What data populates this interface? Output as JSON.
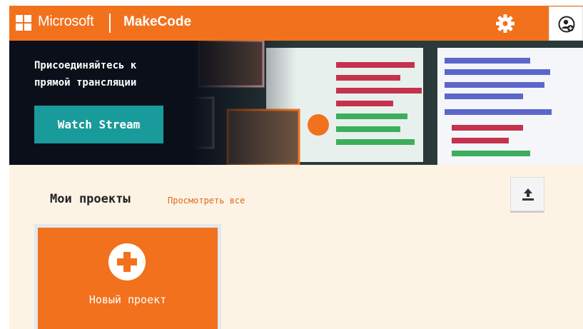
{
  "header": {
    "brand_ms": "Microsoft",
    "brand_product": "MakeCode",
    "settings_icon": "gear-icon",
    "user_icon": "user-sign-in-icon",
    "accent_color": "#f2711c"
  },
  "hero": {
    "title": "Присоединяйтесь к прямой трансляции",
    "button_label": "Watch Stream",
    "button_color": "#1a9b9b"
  },
  "projects": {
    "title": "Мои проекты",
    "view_all": "Просмотреть все",
    "import_icon": "upload-icon",
    "new_project_label": "Новый проект",
    "new_project_icon": "plus-icon"
  }
}
